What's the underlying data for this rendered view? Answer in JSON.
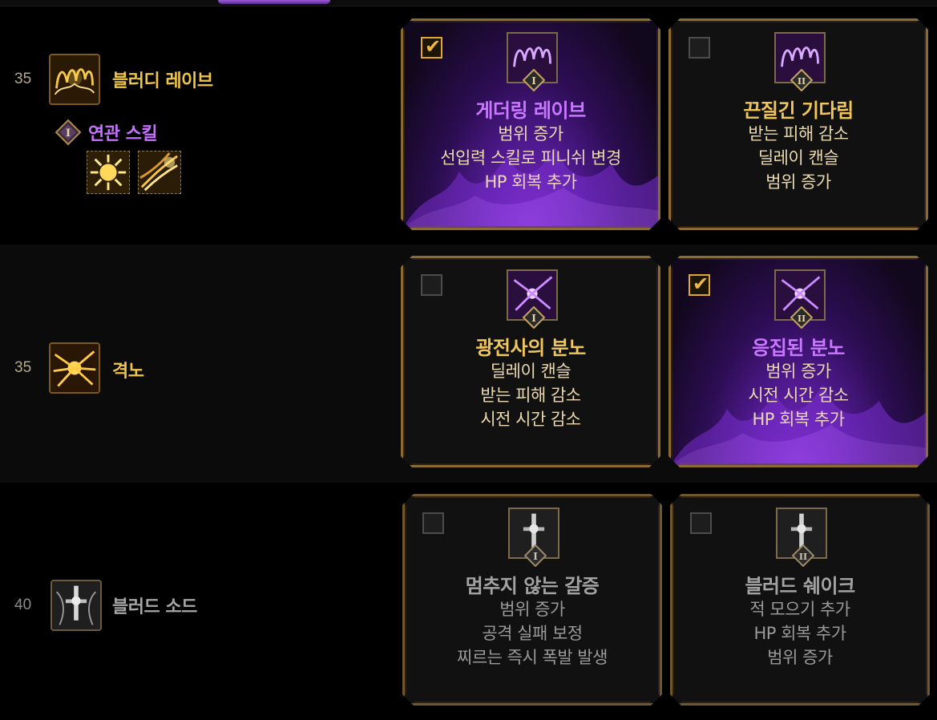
{
  "rows": [
    {
      "level": "35",
      "skill_name": "블러디 레이브",
      "skill_icon": "blood-rave-icon",
      "related": {
        "label": "연관 스킬",
        "tier": "I",
        "icons": [
          "burst-skill-icon",
          "radiant-slash-icon"
        ]
      },
      "options": [
        {
          "tier": "I",
          "selected": true,
          "title": "게더링 레이브",
          "lines": [
            "범위 증가",
            "선입력 스킬로 피니쉬 변경",
            "HP 회복 추가"
          ]
        },
        {
          "tier": "II",
          "selected": false,
          "title": "끈질긴 기다림",
          "lines": [
            "받는 피해 감소",
            "딜레이 캔슬",
            "범위 증가"
          ]
        }
      ]
    },
    {
      "level": "35",
      "skill_name": "격노",
      "skill_icon": "fury-icon",
      "options": [
        {
          "tier": "I",
          "selected": false,
          "title": "광전사의 분노",
          "lines": [
            "딜레이 캔슬",
            "받는 피해 감소",
            "시전 시간 감소"
          ]
        },
        {
          "tier": "II",
          "selected": true,
          "title": "응집된 분노",
          "lines": [
            "범위 증가",
            "시전 시간 감소",
            "HP 회복 추가"
          ]
        }
      ]
    },
    {
      "level": "40",
      "skill_name": "블러드 소드",
      "skill_icon": "blood-sword-icon",
      "options": [
        {
          "tier": "I",
          "selected": false,
          "title": "멈추지 않는 갈증",
          "lines": [
            "범위 증가",
            "공격 실패 보정",
            "찌르는 즉시 폭발 발생"
          ]
        },
        {
          "tier": "II",
          "selected": false,
          "title": "블러드 쉐이크",
          "lines": [
            "적 모으기 추가",
            "HP 회복 추가",
            "범위 증가"
          ]
        }
      ]
    }
  ],
  "colors": {
    "gold": "#f0c64a",
    "purple": "#c977ff",
    "border": "#8a6b34",
    "check": "#f2b83a"
  }
}
